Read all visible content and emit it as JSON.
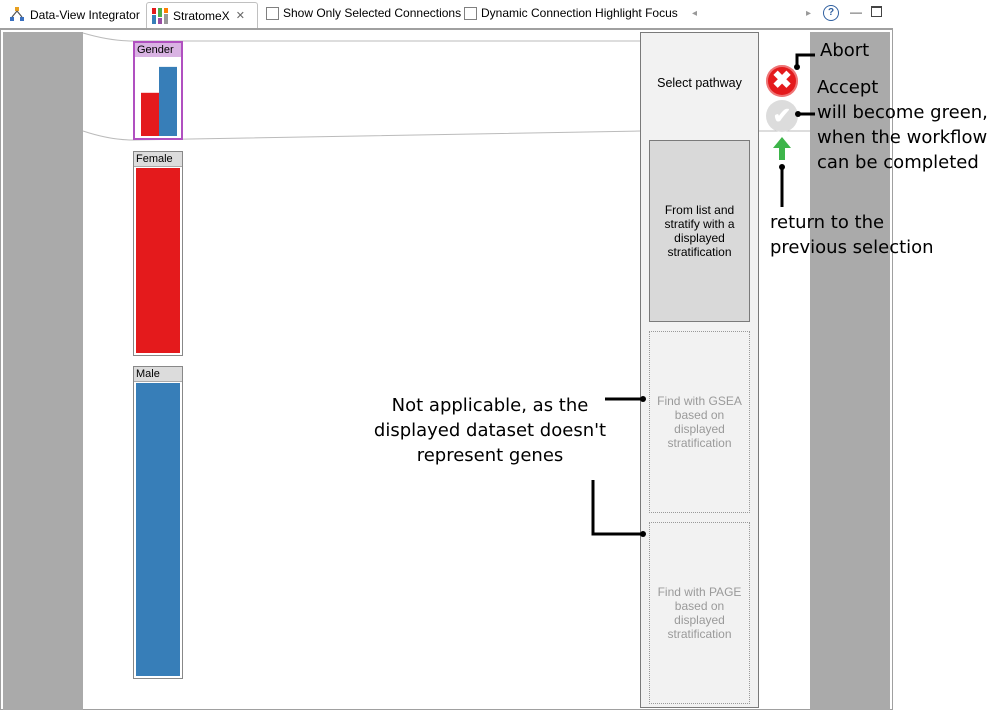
{
  "tabs": [
    {
      "label": "Data-View Integrator",
      "icon": "data-view-integrator-icon"
    },
    {
      "label": "StratomeX",
      "icon": "stratomex-icon",
      "close": "✕"
    }
  ],
  "toolbar": {
    "show_selected_label": "Show Only Selected Connections",
    "dynamic_highlight_label": "Dynamic Connection Highlight Focus",
    "help": "?",
    "scroll_left": "◂",
    "scroll_right": "▸"
  },
  "stratification": {
    "gender_label": "Gender",
    "female_label": "Female",
    "male_label": "Male",
    "colors": {
      "female": "#e41a1c",
      "male": "#377eb8",
      "selected_border": "#b050c0"
    },
    "gender_bar_proportions": {
      "female": 0.6,
      "male": 0.96
    }
  },
  "panel": {
    "title": "Select pathway",
    "option1": "From list and stratify with a displayed stratification",
    "option2": "Find with GSEA based on displayed stratification",
    "option3": "Find with PAGE based on displayed stratification"
  },
  "annotations": {
    "abort": "Abort",
    "accept": "Accept\nwill become green,\nwhen the workflow\ncan be completed",
    "return": "return to the\nprevious selection",
    "not_applicable": "Not applicable, as the\ndisplayed dataset doesn't\nrepresent genes"
  },
  "icons": {
    "abort": "abort-icon",
    "accept": "accept-icon",
    "back": "back-arrow-icon",
    "abort_color": "#e41a1c",
    "accept_color": "#dcdcdc",
    "back_color": "#3db54a"
  }
}
